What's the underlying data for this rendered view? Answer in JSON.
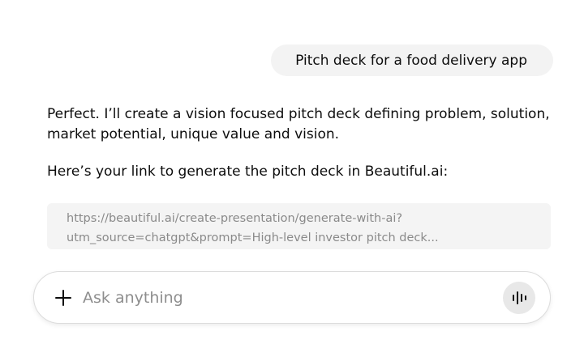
{
  "conversation": {
    "user_message": "Pitch deck for a food delivery app",
    "assistant_paragraph_1": "Perfect. I’ll create a vision focused pitch deck defining problem, solution, market potential, unique value and vision.",
    "assistant_paragraph_2": "Here’s your link to generate the pitch deck in Beautiful.ai:",
    "link_line_1": "https://beautiful.ai/create-presentation/generate-with-ai?",
    "link_line_2": "utm_source=chatgpt&prompt=High-level investor pitch deck..."
  },
  "composer": {
    "placeholder": "Ask anything",
    "value": "",
    "plus_icon": "plus-icon",
    "voice_icon": "voice-waveform-icon"
  },
  "colors": {
    "user_bubble_bg": "#f3f3f3",
    "link_box_bg": "#f4f4f4",
    "link_text": "#8a8a8a",
    "voice_button_bg": "#e8e8e8"
  }
}
